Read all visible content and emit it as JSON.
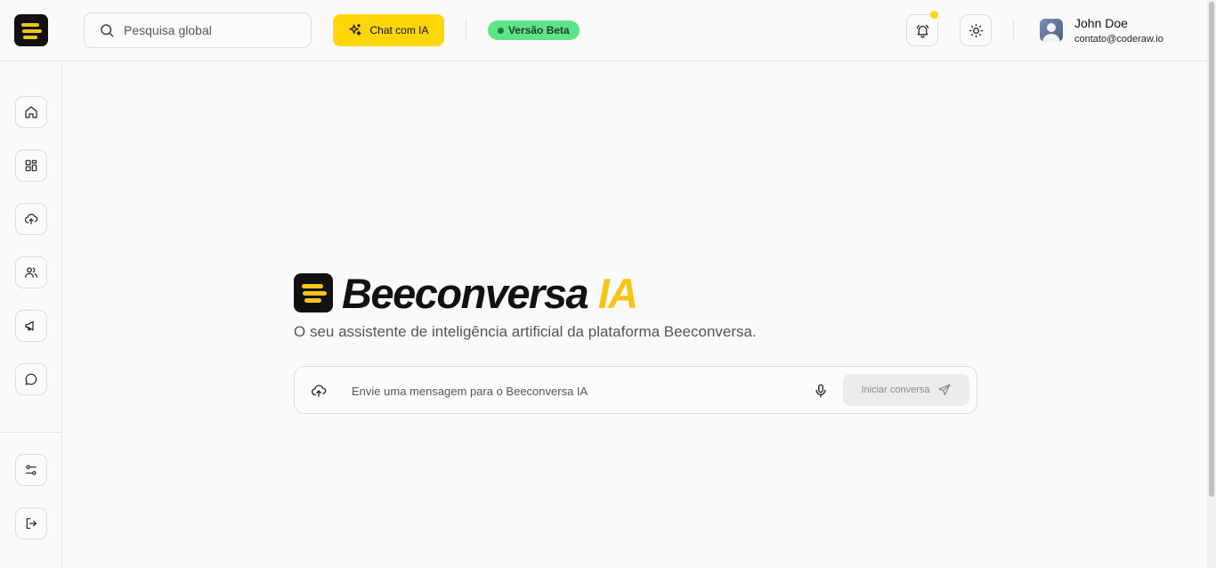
{
  "header": {
    "search_placeholder": "Pesquisa global",
    "chat_button_label": "Chat com IA",
    "beta_badge": "Versão Beta",
    "user": {
      "name": "John Doe",
      "email": "contato@coderaw.io"
    }
  },
  "sidebar": {
    "items": [
      {
        "icon": "home-icon"
      },
      {
        "icon": "dashboard-icon"
      },
      {
        "icon": "upload-cloud-icon"
      },
      {
        "icon": "users-icon"
      },
      {
        "icon": "megaphone-icon"
      },
      {
        "icon": "chat-bubble-icon"
      }
    ],
    "bottom_items": [
      {
        "icon": "settings-sliders-icon"
      },
      {
        "icon": "logout-icon"
      }
    ]
  },
  "main": {
    "brand_name": "Beeconversa",
    "brand_suffix": "IA",
    "tagline": "O seu assistente de inteligência artificial da plataforma Beeconversa.",
    "message_placeholder": "Envie uma mensagem para o Beeconversa IA",
    "send_label": "Iniciar conversa"
  },
  "colors": {
    "accent": "#ffd60a",
    "brand_yellow": "#f5c518",
    "beta_green": "#5de48a",
    "logo_dark": "#111111"
  }
}
